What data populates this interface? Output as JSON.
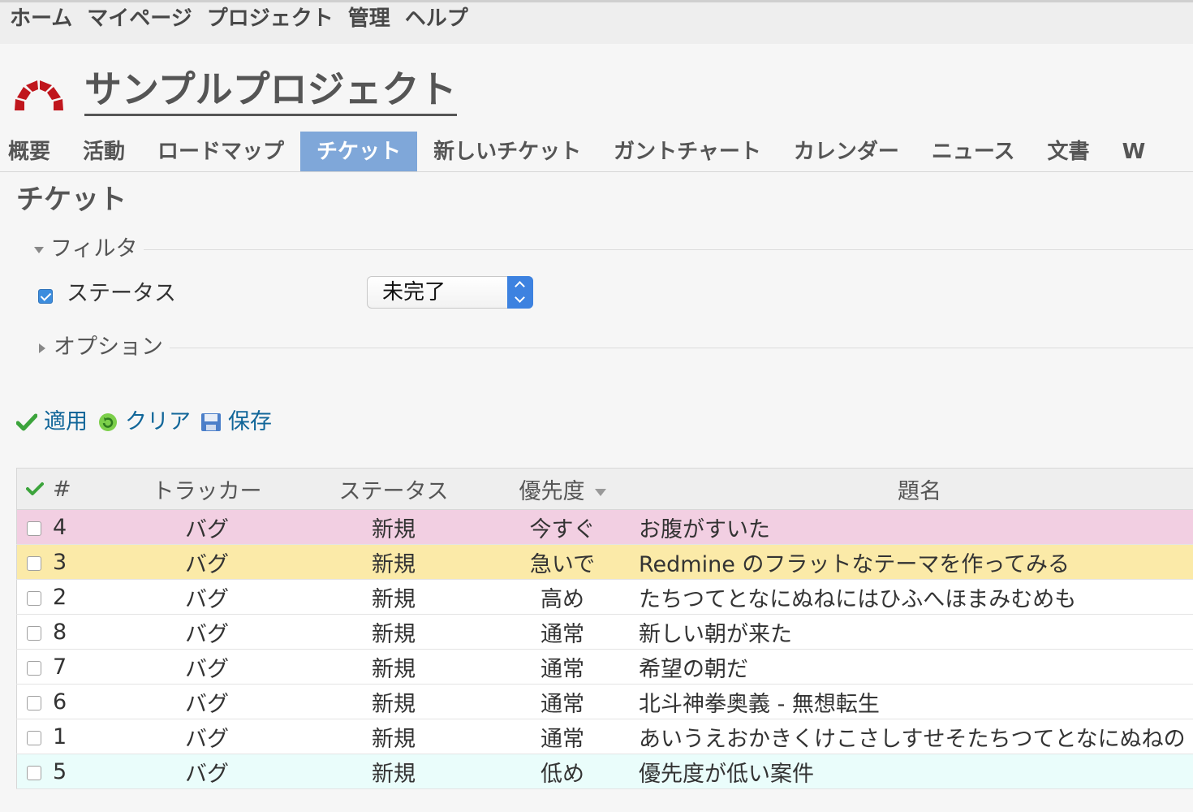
{
  "top_menu": {
    "items": [
      "ホーム",
      "マイページ",
      "プロジェクト",
      "管理",
      "ヘルプ"
    ]
  },
  "header": {
    "project_title": "サンプルプロジェクト",
    "logo_icon": "redmine-logo-icon"
  },
  "main_menu": {
    "tabs": [
      "概要",
      "活動",
      "ロードマップ",
      "チケット",
      "新しいチケット",
      "ガントチャート",
      "カレンダー",
      "ニュース",
      "文書",
      "W"
    ],
    "selected": "チケット"
  },
  "page": {
    "title": "チケット"
  },
  "filters": {
    "legend": "フィルタ",
    "status_label": "ステータス",
    "status_checked": true,
    "status_value": "未完了"
  },
  "options": {
    "legend": "オプション"
  },
  "actions": {
    "apply": "適用",
    "clear": "クリア",
    "save": "保存"
  },
  "table": {
    "columns": {
      "id": "#",
      "tracker": "トラッカー",
      "status": "ステータス",
      "priority": "優先度",
      "subject": "題名"
    },
    "sorted_by": "優先度",
    "rows": [
      {
        "id": "4",
        "tracker": "バグ",
        "status": "新規",
        "priority": "今すぐ",
        "subject": "お腹がすいた"
      },
      {
        "id": "3",
        "tracker": "バグ",
        "status": "新規",
        "priority": "急いで",
        "subject": "Redmine のフラットなテーマを作ってみる"
      },
      {
        "id": "2",
        "tracker": "バグ",
        "status": "新規",
        "priority": "高め",
        "subject": "たちつてとなにぬねにはひふへほまみむめも"
      },
      {
        "id": "8",
        "tracker": "バグ",
        "status": "新規",
        "priority": "通常",
        "subject": "新しい朝が来た"
      },
      {
        "id": "7",
        "tracker": "バグ",
        "status": "新規",
        "priority": "通常",
        "subject": "希望の朝だ"
      },
      {
        "id": "6",
        "tracker": "バグ",
        "status": "新規",
        "priority": "通常",
        "subject": "北斗神拳奥義 - 無想転生"
      },
      {
        "id": "1",
        "tracker": "バグ",
        "status": "新規",
        "priority": "通常",
        "subject": "あいうえおかきくけこさしすせそたちつてとなにぬねの"
      },
      {
        "id": "5",
        "tracker": "バグ",
        "status": "新規",
        "priority": "低め",
        "subject": "優先度が低い案件"
      }
    ]
  },
  "colors": {
    "accent": "#7fa7d9",
    "link": "#116699",
    "priority_immediate_bg": "#f2cfe2",
    "priority_urgent_bg": "#fbeaa8",
    "priority_high_text": "#a3154f",
    "priority_low_bg": "#eafdfb"
  }
}
